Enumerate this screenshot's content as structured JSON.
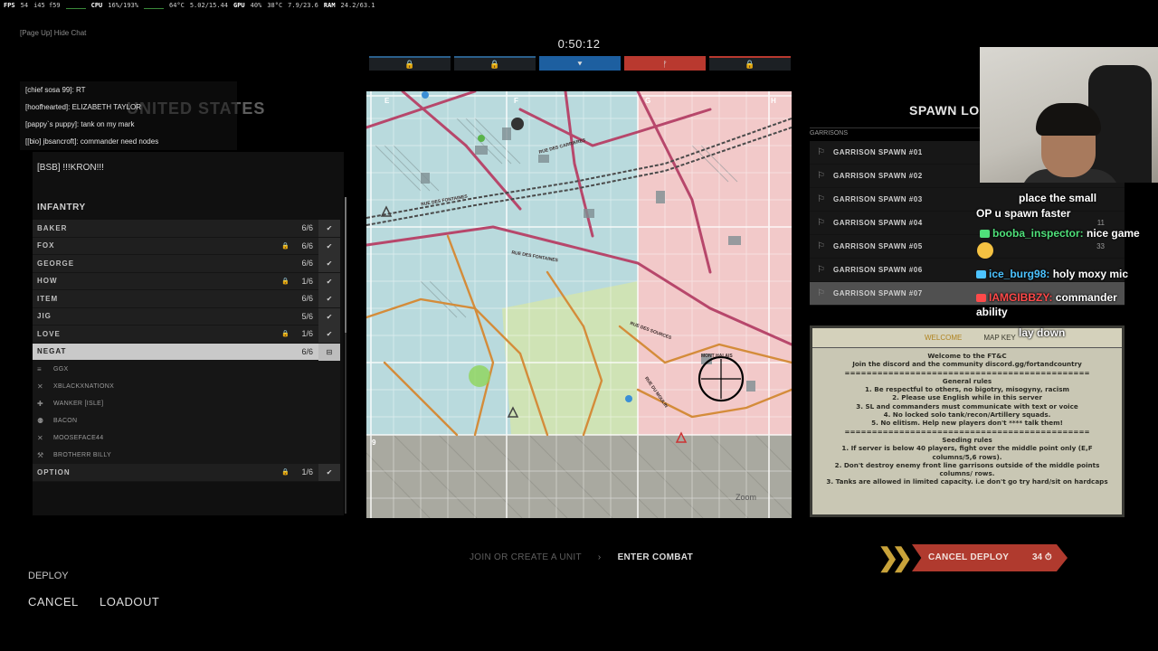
{
  "perf": {
    "fps_label": "FPS",
    "fps": "54",
    "fps_detail": "i45 f59",
    "cpu_label": "CPU",
    "cpu": "16%/193%",
    "cpu_temp": "64°C",
    "cpu_clock": "5.02/15.44",
    "gpu_label": "GPU",
    "gpu": "40%",
    "gpu_temp": "38°C",
    "gpu_mem": "7.9/23.6",
    "ram_label": "RAM",
    "ram": "24.2/63.1"
  },
  "hotkey": "[Page Up] Hide Chat",
  "timer": "0:50:12",
  "capture_points": [
    {
      "icon": "lock-icon",
      "glyph": "🔒",
      "side": "neutral"
    },
    {
      "icon": "lock-icon",
      "glyph": "🔒",
      "side": "neutral"
    },
    {
      "icon": "us-capture-icon",
      "glyph": "⯆",
      "side": "us"
    },
    {
      "icon": "ger-capture-icon",
      "glyph": "ᚠ",
      "side": "ger"
    },
    {
      "icon": "lock-icon",
      "glyph": "🔒",
      "side": "gerd"
    }
  ],
  "chat": [
    "[chief sosa 99]: RT",
    "[hoofhearted]: ELIZABETH TAYLOR",
    "[pappy`s puppy]: tank on my mark",
    "[[bio] jbsancroft]: commander need nodes"
  ],
  "faction": "UNITED STATES",
  "squad_name": "[BSB] !!!KRON!!!",
  "section_title": "INFANTRY",
  "units": [
    {
      "name": "BAKER",
      "count": "6/6",
      "locked": false,
      "selected": false
    },
    {
      "name": "FOX",
      "count": "6/6",
      "locked": true,
      "selected": false
    },
    {
      "name": "GEORGE",
      "count": "6/6",
      "locked": false,
      "selected": false
    },
    {
      "name": "HOW",
      "count": "1/6",
      "locked": true,
      "selected": false
    },
    {
      "name": "ITEM",
      "count": "6/6",
      "locked": false,
      "selected": false
    },
    {
      "name": "JIG",
      "count": "5/6",
      "locked": false,
      "selected": false
    },
    {
      "name": "LOVE",
      "count": "1/6",
      "locked": true,
      "selected": false
    },
    {
      "name": "NEGAT",
      "count": "6/6",
      "locked": false,
      "selected": true
    }
  ],
  "members": [
    {
      "name": "GGX",
      "icon": "officer-icon",
      "glyph": "≡"
    },
    {
      "name": "XBLACKXNATIONX",
      "icon": "rifle-icon",
      "glyph": "✕"
    },
    {
      "name": "WANKER [ISLE]",
      "icon": "medic-icon",
      "glyph": "✚"
    },
    {
      "name": "BACON",
      "icon": "support-icon",
      "glyph": "⚉"
    },
    {
      "name": "MOOSEFACE44",
      "icon": "rifle-icon",
      "glyph": "✕"
    },
    {
      "name": "BROTHERR BILLY",
      "icon": "engineer-icon",
      "glyph": "⚒"
    }
  ],
  "option_unit": {
    "name": "OPTION",
    "count": "1/6",
    "locked": true
  },
  "map": {
    "grid_cols": [
      "E",
      "F",
      "G",
      "H"
    ],
    "rows": [
      "9"
    ],
    "street_labels": [
      "RUE DES CARRIERES",
      "RUE DES FONTAINES",
      "RUE DES FONTAINES",
      "RUE DES SOURCES",
      "RUE DU MOULIN",
      "MONT HALAIS"
    ],
    "zoom_hint": "Zoom"
  },
  "spawn": {
    "title": "SPAWN LOC",
    "subheader": "GARRISONS",
    "items": [
      {
        "name": "GARRISON SPAWN #01",
        "count": ""
      },
      {
        "name": "GARRISON SPAWN #02",
        "count": ""
      },
      {
        "name": "GARRISON SPAWN #03",
        "count": ""
      },
      {
        "name": "GARRISON SPAWN #04",
        "count": "11"
      },
      {
        "name": "GARRISON SPAWN #05",
        "count": "33"
      },
      {
        "name": "GARRISON SPAWN #06",
        "count": ""
      },
      {
        "name": "GARRISON SPAWN #07",
        "count": ""
      }
    ]
  },
  "welcome": {
    "tab_active": "WELCOME",
    "tab_other": "MAP KEY",
    "lines": [
      "Welcome to the FT&C",
      "Join the discord and the community discord.gg/fortandcountry",
      "=============================================",
      "General rules",
      "1. Be respectful to others, no bigotry, misogyny, racism",
      "2. Please use English while in this server",
      "3. SL and commanders must communicate with text or voice",
      "4. No locked solo tank/recon/Artillery squads.",
      "5. No elitism. Help new players don't **** talk them!",
      "=============================================",
      "Seeding rules",
      "1. If server is below 40 players, fight over the middle point only (E,F columns/5,6 rows).",
      "2. Don't destroy enemy front line garrisons outside of the middle points columns/ rows.",
      "3. Tanks are allowed in limited capacity. i.e don't go try hard/sit on hardcaps"
    ]
  },
  "bottom_nav": {
    "join": "JOIN OR CREATE A UNIT",
    "arrow": "›",
    "enter": "ENTER COMBAT"
  },
  "cancel_deploy": {
    "label": "CANCEL DEPLOY",
    "count": "34",
    "chevrons": "❯❯"
  },
  "actions": {
    "deploy": "DEPLOY",
    "cancel": "CANCEL",
    "loadout": "LOADOUT"
  },
  "twitch": [
    {
      "user": "",
      "text": "place the small",
      "user_color": "#b07cff"
    },
    {
      "user": "",
      "text": "OP u spawn faster",
      "user_color": ""
    },
    {
      "user": "booba_inspector:",
      "text": "nice game",
      "user_color": "#4fe07a"
    },
    {
      "user": "ice_burg98:",
      "text": "holy moxy mic",
      "user_color": "#4cc3ff"
    },
    {
      "user": "IAMGIBBZY:",
      "text": "commander",
      "user_color": "#ff4a4a"
    },
    {
      "user": "",
      "text": "ability",
      "user_color": ""
    },
    {
      "user": "",
      "text": "lay down",
      "user_color": "#4fe07a"
    }
  ]
}
